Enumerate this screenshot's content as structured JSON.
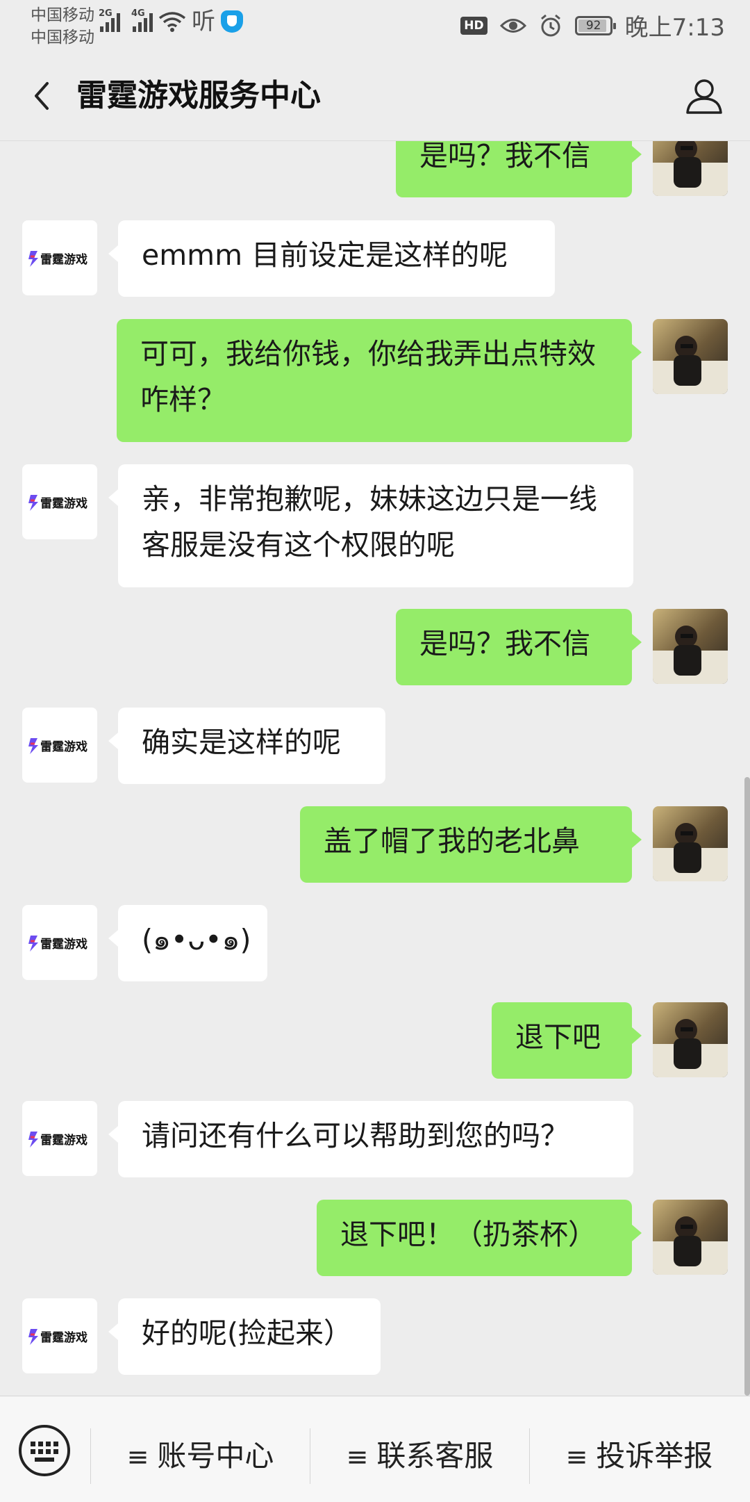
{
  "status_bar": {
    "carrier1": "中国移动",
    "carrier2": "中国移动",
    "net1": "2G",
    "net2": "4G",
    "listen": "听",
    "hd": "HD",
    "battery": "92",
    "time": "晚上7:13"
  },
  "header": {
    "title": "雷霆游戏服务中心"
  },
  "chat": {
    "messages": [
      {
        "from": "user",
        "text": "是吗？我不信"
      },
      {
        "from": "service",
        "text": "emmm 目前设定是这样的呢"
      },
      {
        "from": "user",
        "text": "可可，我给你钱，你给我弄出点特效咋样？"
      },
      {
        "from": "service",
        "text": "亲，非常抱歉呢，妹妹这边只是一线客服是没有这个权限的呢"
      },
      {
        "from": "user",
        "text": "是吗？我不信"
      },
      {
        "from": "service",
        "text": "确实是这样的呢"
      },
      {
        "from": "user",
        "text": "盖了帽了我的老北鼻"
      },
      {
        "from": "service",
        "text": "(๑•ᴗ•๑)"
      },
      {
        "from": "user",
        "text": "退下吧"
      },
      {
        "from": "service",
        "text": "请问还有什么可以帮助到您的吗？"
      },
      {
        "from": "user",
        "text": "退下吧！（扔茶杯）"
      },
      {
        "from": "service",
        "text": "好的呢(捡起来）"
      }
    ]
  },
  "service_logo": "雷霆游戏",
  "bottom_menu": {
    "items": [
      "账号中心",
      "联系客服",
      "投诉举报"
    ]
  },
  "colors": {
    "user_bubble": "#95ec69",
    "service_bubble": "#ffffff",
    "background": "#ededed"
  }
}
